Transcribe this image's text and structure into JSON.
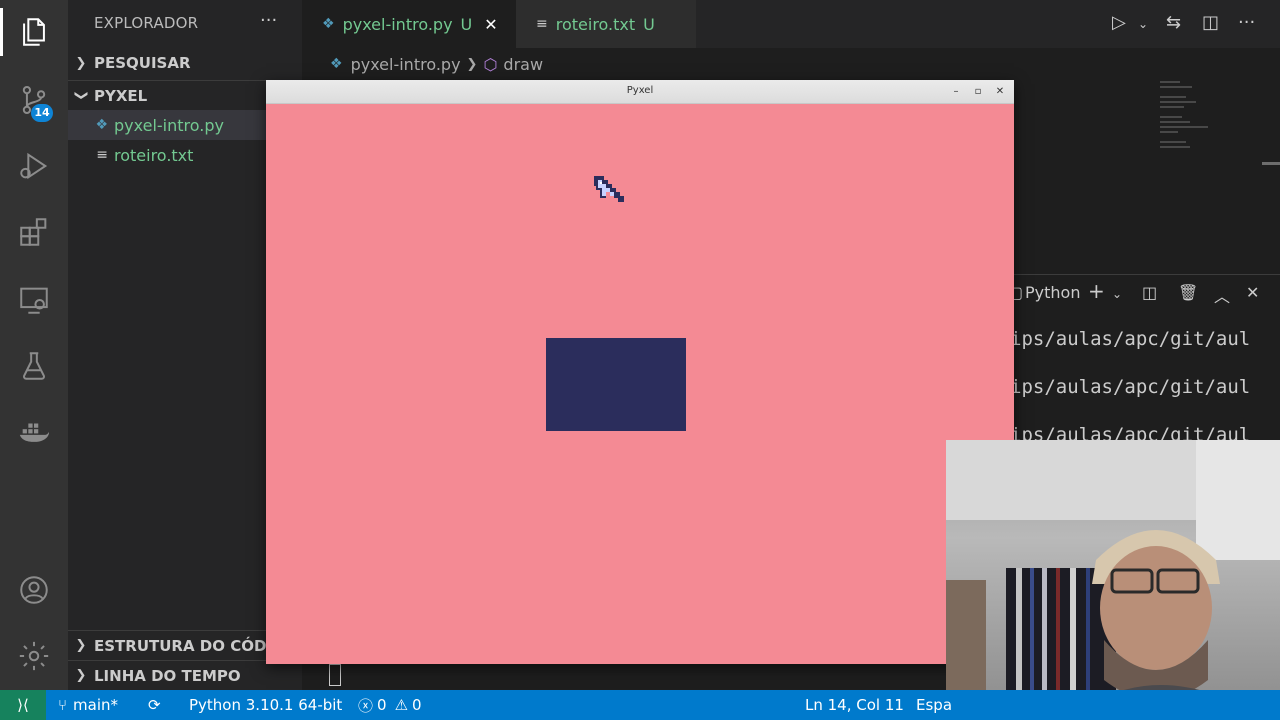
{
  "sidebar": {
    "title": "EXPLORADOR",
    "more": "···",
    "search_section": "PESQUISAR",
    "project_section": "PYXEL",
    "files": [
      {
        "name": "pyxel-intro.py",
        "icon": "python-icon"
      },
      {
        "name": "roteiro.txt",
        "icon": "text-file-icon"
      }
    ],
    "outline_section": "ESTRUTURA DO CÓDIGO",
    "timeline_section": "LINHA DO TEMPO"
  },
  "activity": {
    "scm_badge": "14"
  },
  "tabs": [
    {
      "label": "pyxel-intro.py",
      "status": "U",
      "close": "✕"
    },
    {
      "label": "roteiro.txt",
      "status": "U"
    }
  ],
  "breadcrumb": {
    "file": "pyxel-intro.py",
    "symbol": "draw"
  },
  "terminal": {
    "shell": "Python",
    "lines": [
      "ips/aulas/apc/git/aul",
      "ips/aulas/apc/git/aul",
      "ips/aulas/apc/git/aul"
    ]
  },
  "pyxel_window": {
    "title": "Pyxel",
    "minimize": "–",
    "maximize": "▫",
    "close": "✕",
    "background_color": "#f48a94",
    "rect_color": "#2b2d5c"
  },
  "status": {
    "branch": "main*",
    "python": "Python 3.10.1 64-bit",
    "errors": "0",
    "warnings": "0",
    "position": "Ln 14, Col 11",
    "language": "Espa"
  },
  "colors": {
    "accent": "#007acc",
    "remote": "#16825d",
    "untracked": "#73c991"
  }
}
